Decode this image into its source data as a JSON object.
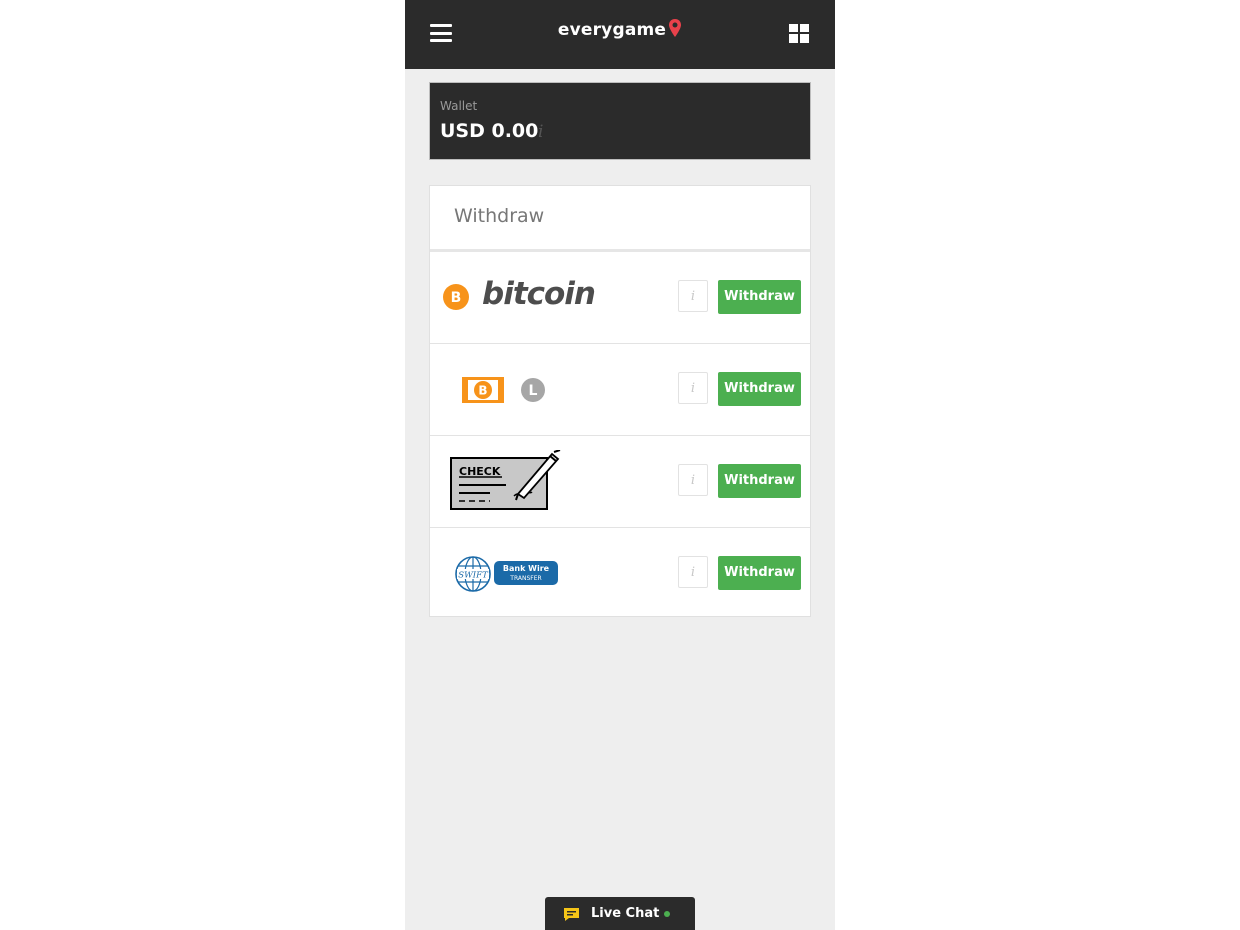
{
  "header": {
    "logo_text": "everygame",
    "menu_icon": "hamburger-menu-icon",
    "apps_icon": "grid-apps-icon"
  },
  "wallet": {
    "label": "Wallet",
    "amount": "USD 0.00",
    "info_icon": "info-icon"
  },
  "withdraw_section": {
    "title": "Withdraw",
    "methods": [
      {
        "name": "bitcoin",
        "logo_text": "bitcoin",
        "info_label": "i",
        "button_label": "Withdraw"
      },
      {
        "name": "bitcoin-cash-litecoin",
        "info_label": "i",
        "button_label": "Withdraw"
      },
      {
        "name": "check",
        "logo_text": "CHECK",
        "info_label": "i",
        "button_label": "Withdraw"
      },
      {
        "name": "swift-bank-wire",
        "logo_text_1": "Bank Wire",
        "logo_text_2": "TRANSFER",
        "logo_text_3": "SWIFT",
        "info_label": "i",
        "button_label": "Withdraw"
      }
    ]
  },
  "live_chat": {
    "label": "Live Chat",
    "status": "online"
  },
  "colors": {
    "header_bg": "#2b2b2b",
    "page_bg": "#eeeeee",
    "withdraw_button": "#4caf50",
    "bitcoin_orange": "#f7931a",
    "logo_pin_red": "#e8414b",
    "swift_blue": "#1b6aa8"
  }
}
